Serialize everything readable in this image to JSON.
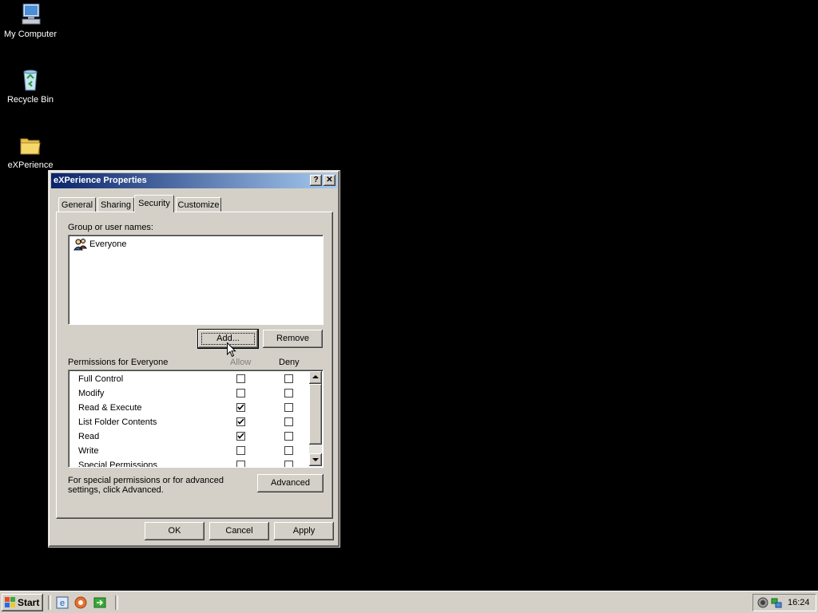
{
  "desktop": {
    "icons": [
      {
        "label": "My Computer",
        "icon": "computer-icon"
      },
      {
        "label": "Recycle Bin",
        "icon": "recycle-bin-icon"
      },
      {
        "label": "eXPerience",
        "icon": "folder-icon"
      }
    ]
  },
  "dialog": {
    "title": "eXPerience Properties",
    "help_button": "?",
    "close_button": "✕",
    "tabs": [
      {
        "label": "General",
        "active": false
      },
      {
        "label": "Sharing",
        "active": false
      },
      {
        "label": "Security",
        "active": true
      },
      {
        "label": "Customize",
        "active": false
      }
    ],
    "group_label": "Group or user names:",
    "users": [
      {
        "name": "Everyone",
        "icon": "user-group-icon",
        "selected": false
      }
    ],
    "add_button": "Add...",
    "remove_button": "Remove",
    "permissions_label": "Permissions for Everyone",
    "allow_header": "Allow",
    "deny_header": "Deny",
    "permissions": [
      {
        "name": "Full Control",
        "allow": false,
        "deny": false
      },
      {
        "name": "Modify",
        "allow": false,
        "deny": false
      },
      {
        "name": "Read & Execute",
        "allow": true,
        "deny": false
      },
      {
        "name": "List Folder Contents",
        "allow": true,
        "deny": false
      },
      {
        "name": "Read",
        "allow": true,
        "deny": false
      },
      {
        "name": "Write",
        "allow": false,
        "deny": false
      },
      {
        "name": "Special Permissions",
        "allow": false,
        "deny": false
      }
    ],
    "advanced_note": "For special permissions or for advanced settings, click Advanced.",
    "advanced_button": "Advanced",
    "ok_button": "OK",
    "cancel_button": "Cancel",
    "apply_button": "Apply"
  },
  "taskbar": {
    "start_label": "Start",
    "quick_launch": [
      "ie-icon",
      "browser-icon",
      "show-desktop-icon"
    ],
    "clock": "16:24"
  },
  "colors": {
    "desktop": "#000000",
    "titlebar_start": "#0a246a",
    "titlebar_end": "#a6caf0",
    "face": "#d4d0c8"
  }
}
